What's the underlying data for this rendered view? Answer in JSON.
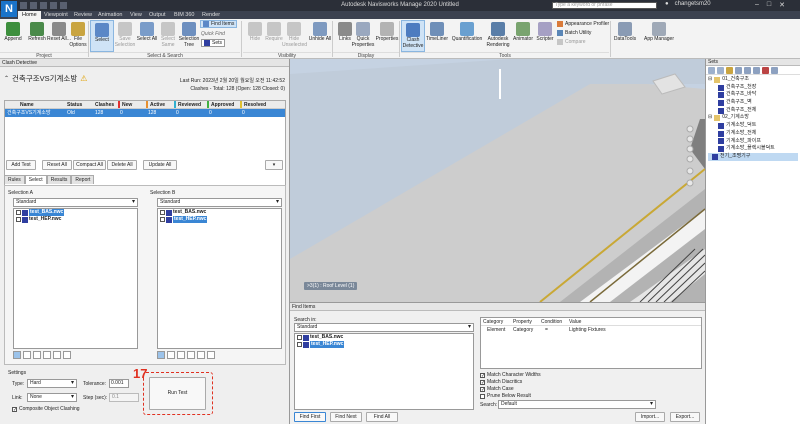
{
  "app": {
    "title": "Autodesk Navisworks Manage 2020   Untitled",
    "logo": "N",
    "search_placeholder": "Type a keyword or phrase",
    "user": "changetsm20"
  },
  "tabs": [
    "Home",
    "Viewpoint",
    "Review",
    "Animation",
    "View",
    "Output",
    "BIM 360",
    "Render"
  ],
  "ribbon": {
    "project": [
      "Append",
      "Refresh",
      "Reset All...",
      "File Options"
    ],
    "select": [
      "Select",
      "Save Selection",
      "Select All",
      "Select Same",
      "Selection Tree"
    ],
    "find_items": "Find Items",
    "quick_find": "Quick Find",
    "sets": "Sets",
    "visibility": [
      "Hide",
      "Require",
      "Hide Unselected",
      "Unhide All"
    ],
    "display": [
      "Links",
      "Quick Properties",
      "Properties"
    ],
    "tools": [
      "Clash Detective",
      "TimeLiner",
      "Quantification",
      "Autodesk Rendering",
      "Animator",
      "Scripter"
    ],
    "tools_small": [
      "Appearance Profiler",
      "Batch Utility",
      "Compare"
    ],
    "extra": [
      "DataTools",
      "App Manager"
    ],
    "groups": [
      "Project",
      "Select & Search",
      "Visibility",
      "Display",
      "Tools"
    ]
  },
  "clash": {
    "panel_title": "Clash Detective",
    "test_name": "건축구조VS기계소방",
    "last_run": "Last Run:  2023년 2월 20일 월요일 오전 11:42:52",
    "summary": "Clashes - Total: 128  (Open: 128  Closed: 0)",
    "headers": [
      "Name",
      "Status",
      "Clashes",
      "New",
      "Active",
      "Reviewed",
      "Approved",
      "Resolved"
    ],
    "row": [
      "건축구조VS기계소방",
      "Old",
      "128",
      "0",
      "128",
      "0",
      "0",
      "0"
    ],
    "buttons": [
      "Add Test",
      "Reset All",
      "Compact All",
      "Delete All",
      "Update All"
    ],
    "tabs": [
      "Rules",
      "Select",
      "Results",
      "Report"
    ],
    "selection_a_title": "Selection A",
    "selection_b_title": "Selection B",
    "selection_mode": "Standard",
    "files_a": [
      "test_BAS.nwc",
      "test_HEP.nwc"
    ],
    "files_b": [
      "test_BAS.nwc",
      "test_HEP.nwc"
    ],
    "settings_title": "Settings",
    "type_label": "Type:",
    "type_value": "Hard",
    "tolerance_label": "Tolerance:",
    "tolerance_value": "0.001 m",
    "link_label": "Link:",
    "link_value": "None",
    "step_label": "Step (sec):",
    "step_value": "0.1",
    "composite": "Composite Object Clashing",
    "run_test": "Run Test",
    "annotation": "17"
  },
  "viewport": {
    "label": ">3(1) : Roof Level (1)"
  },
  "sets_panel": {
    "title": "Sets",
    "items": [
      {
        "label": "01_건축구조",
        "type": "folder",
        "depth": 0
      },
      {
        "label": "건축구조_천장",
        "type": "set",
        "depth": 1
      },
      {
        "label": "건축구조_바닥",
        "type": "set",
        "depth": 1
      },
      {
        "label": "건축구조_벽",
        "type": "set",
        "depth": 1
      },
      {
        "label": "건축구조_전체",
        "type": "set",
        "depth": 1
      },
      {
        "label": "02_기계소방",
        "type": "folder",
        "depth": 0
      },
      {
        "label": "기계소방_덕트",
        "type": "set",
        "depth": 1
      },
      {
        "label": "기계소방_전체",
        "type": "set",
        "depth": 1
      },
      {
        "label": "기계소방_파이프",
        "type": "set",
        "depth": 1
      },
      {
        "label": "기계소방_플렉시블덕트",
        "type": "set",
        "depth": 1
      },
      {
        "label": "전기_조명기구",
        "type": "set",
        "depth": 0
      }
    ]
  },
  "find": {
    "title": "Find Items",
    "search_in": "Search in:",
    "mode": "Standard",
    "files": [
      "test_BAS.nwc",
      "test_HEP.nwc"
    ],
    "cond_headers": [
      "Category",
      "Property",
      "Condition",
      "Value"
    ],
    "cond_row": [
      "Element",
      "Category",
      "=",
      "Lighting Fixtures"
    ],
    "options": [
      "Match Character Widths",
      "Match Diacritics",
      "Match Case",
      "Prune Below Result"
    ],
    "search_label": "Search:",
    "search_value": "Default",
    "buttons": [
      "Find First",
      "Find Next",
      "Find All",
      "Import...",
      "Export..."
    ]
  },
  "colors": {
    "accent": "#3a86d4",
    "annotation": "#e03020",
    "titlebar": "#2b2f38"
  }
}
